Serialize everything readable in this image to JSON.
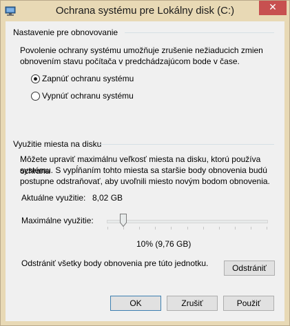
{
  "window": {
    "title": "Ochrana systému pre Lokálny disk (C:)",
    "close_glyph": "✕"
  },
  "restore_settings": {
    "group_title": "Nastavenie pre obnovovanie",
    "description_line1": "Povolenie ochrany systému umožňuje zrušenie nežiaducich zmien",
    "description_line2": "obnovením stavu počítača v predchádzajúcom bode v čase.",
    "radio_on_label": "Zapnúť ochranu systému",
    "radio_off_label": "Vypnúť ochranu systému",
    "selected": "on"
  },
  "disk_usage": {
    "group_title": "Využitie miesta na disku",
    "description_line1": "Môžete upraviť maximálnu veľkosť miesta na disku, ktorú používa ochrana",
    "description_line2": "systému. S vypĺňaním tohto miesta sa staršie body obnovenia budú",
    "description_line3": "postupne odstraňovať, aby uvoľnili miesto novým bodom obnovenia.",
    "current_label": "Aktuálne využitie:",
    "current_value": "8,02 GB",
    "max_label": "Maximálne využitie:",
    "max_value_text": "10% (9,76 GB)",
    "max_percent": 10,
    "delete_text": "Odstrániť všetky body obnovenia pre túto jednotku.",
    "delete_button": "Odstrániť"
  },
  "footer": {
    "ok": "OK",
    "cancel": "Zrušiť",
    "apply": "Použiť"
  },
  "icons": {
    "app": "system-protection-icon",
    "close": "close-icon"
  },
  "colors": {
    "titlebar": "#e8d9b5",
    "close": "#c75050",
    "client": "#f0f0f0",
    "default_button_border": "#3c7fb1"
  }
}
